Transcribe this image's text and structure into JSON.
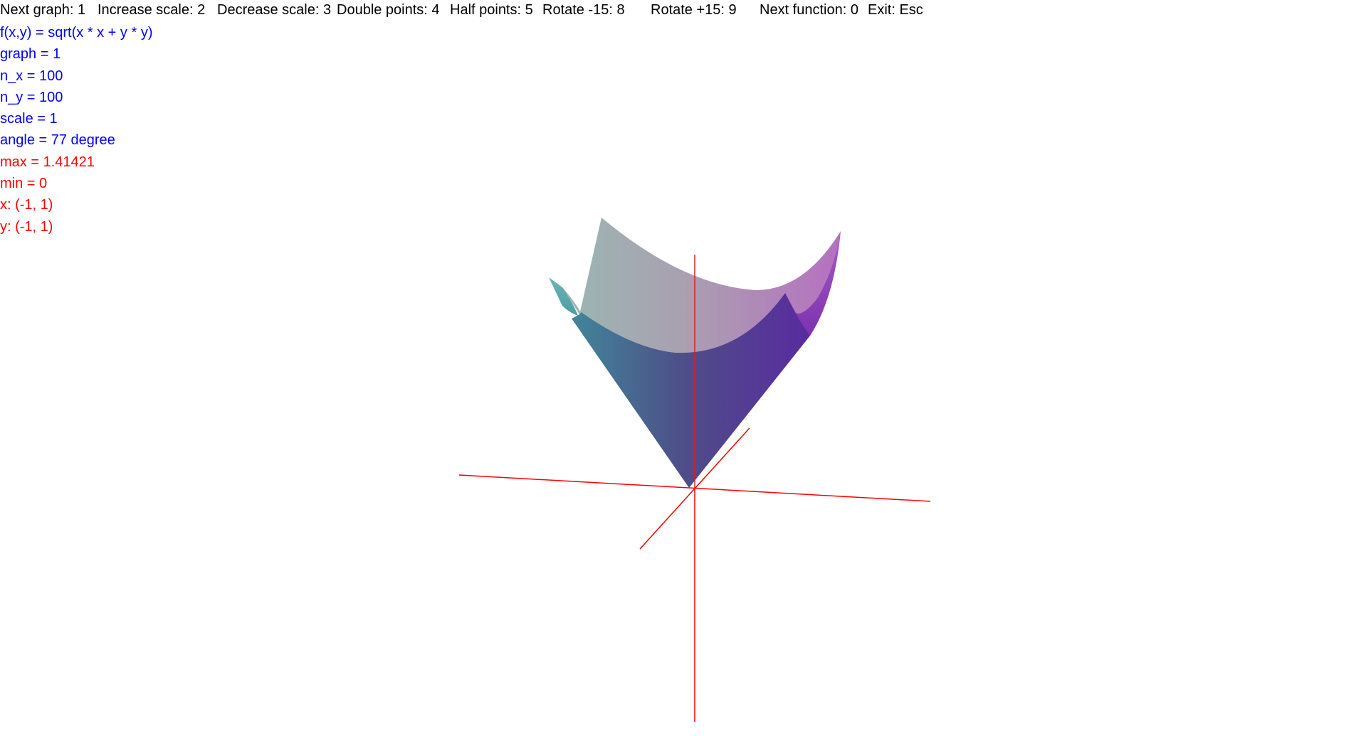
{
  "help_bar": {
    "items": [
      "Next graph: 1",
      "Increase scale: 2",
      "Decrease scale: 3",
      "Double points: 4",
      "Half points: 5",
      "Rotate -15: 8",
      "Rotate +15: 9",
      "Next function: 0",
      "Exit: Esc"
    ]
  },
  "info": {
    "function": "f(x,y) = sqrt(x * x + y * y)",
    "graph": "graph = 1",
    "n_x": "n_x = 100",
    "n_y": "n_y = 100",
    "scale": "scale = 1",
    "angle": "angle = 77 degree",
    "max": "max = 1.41421",
    "min": "min = 0",
    "x_range": "x: (-1, 1)",
    "y_range": "y: (-1, 1)"
  },
  "colors": {
    "help_text": "#000000",
    "params_text": "#0000ff",
    "range_text": "#ff0000",
    "axis": "#ff0000",
    "surface_corner_x_min": "#5ab2b4",
    "surface_corner_x_max": "#a04ec0",
    "surface_apex": "#4a4e8c",
    "surface_back": "#a8a8b4"
  },
  "graph": {
    "function": "sqrt(x * x + y * y)",
    "x_range": [
      -1,
      1
    ],
    "y_range": [
      -1,
      1
    ],
    "z_range": [
      0,
      1.41421
    ],
    "angle_degree": 77,
    "scale": 1
  }
}
